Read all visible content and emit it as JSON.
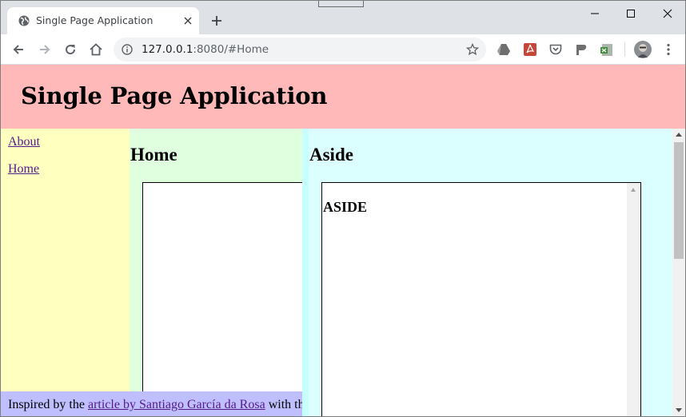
{
  "browser": {
    "tab_title": "Single Page Application",
    "url_host": "127.0.0.1",
    "url_rest": ":8080/#Home",
    "icons": [
      "globe-icon",
      "close-icon",
      "plus-icon",
      "back-icon",
      "forward-icon",
      "reload-icon",
      "home-icon",
      "info-icon",
      "star-icon",
      "drive-icon",
      "pdf-icon",
      "pocket-icon",
      "flag-icon",
      "sheets-icon",
      "avatar",
      "menu-icon"
    ]
  },
  "page": {
    "title": "Single Page Application",
    "nav": [
      {
        "label": "About"
      },
      {
        "label": "Home"
      }
    ],
    "main_heading": "Home",
    "aside_heading": "Aside",
    "aside_content": "ASIDE",
    "footer": {
      "prefix": "Inspired by the ",
      "link": "article by Santiago García da Rosa",
      "suffix": " with th"
    }
  },
  "colors": {
    "header": "#ffb9b9",
    "nav": "#ffffc0",
    "main": "#dfffdf",
    "aside": "#dbffff",
    "footer": "#bfbfff",
    "link_visited": "#551a8b"
  }
}
